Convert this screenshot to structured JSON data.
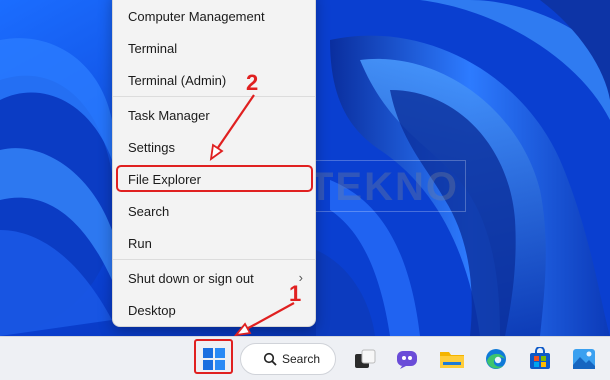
{
  "menu": {
    "items": [
      {
        "label": "Computer Management"
      },
      {
        "label": "Terminal"
      },
      {
        "label": "Terminal (Admin)"
      },
      {
        "label": "Task Manager"
      },
      {
        "label": "Settings"
      },
      {
        "label": "File Explorer"
      },
      {
        "label": "Search"
      },
      {
        "label": "Run"
      },
      {
        "label": "Shut down or sign out",
        "submenu_icon": "chevron-right-icon"
      },
      {
        "label": "Desktop"
      }
    ],
    "highlighted": "File Explorer"
  },
  "callouts": {
    "step1": "1",
    "step2": "2"
  },
  "watermark": "BAGITEKNO",
  "taskbar": {
    "search_label": "Search",
    "icons": [
      "windows-start-icon",
      "search-icon",
      "task-view-icon",
      "copilot-icon",
      "file-explorer-icon",
      "edge-icon",
      "store-icon",
      "photos-icon"
    ]
  },
  "colors": {
    "highlight": "#e02020",
    "wallpaper": "#0a3fd0",
    "menu_bg": "#f3f3f3"
  }
}
